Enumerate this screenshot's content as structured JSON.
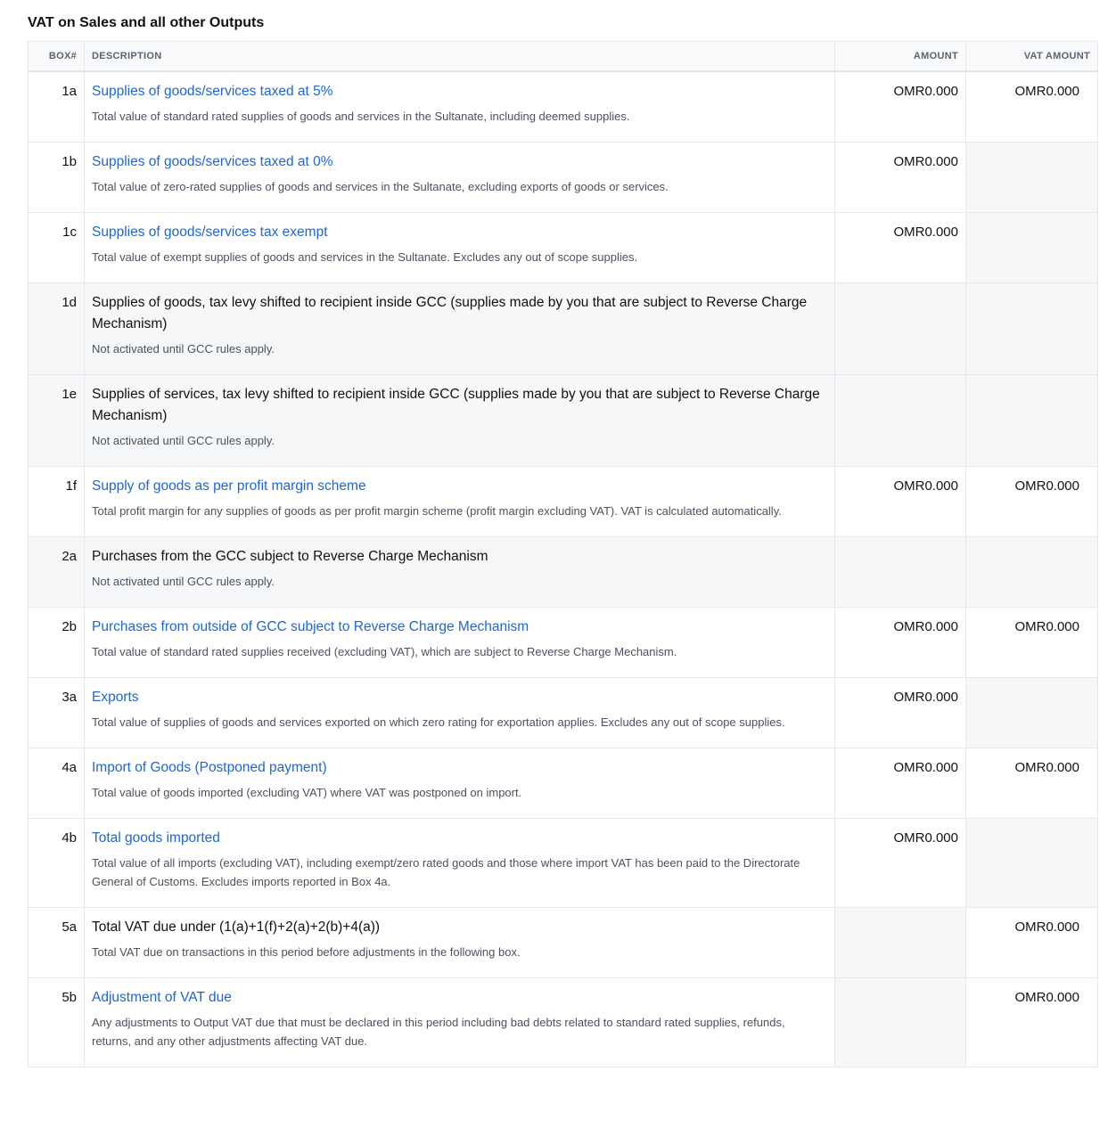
{
  "section_title": "VAT on Sales and all other Outputs",
  "headers": {
    "box": "BOX#",
    "description": "DESCRIPTION",
    "amount": "AMOUNT",
    "vat_amount": "VAT AMOUNT"
  },
  "rows": [
    {
      "box": "1a",
      "label": "Supplies of goods/services taxed at 5%",
      "help": "Total value of standard rated supplies of goods and services in the Sultanate, including deemed supplies.",
      "amount": "OMR0.000",
      "vat_amount": "OMR0.000",
      "linked": true
    },
    {
      "box": "1b",
      "label": "Supplies of goods/services taxed at 0%",
      "help": "Total value of zero-rated supplies of goods and services in the Sultanate, excluding exports of goods or services.",
      "amount": "OMR0.000",
      "vat_amount": "",
      "linked": true
    },
    {
      "box": "1c",
      "label": "Supplies of goods/services tax exempt",
      "help": "Total value of exempt supplies of goods and services in the Sultanate. Excludes any out of scope supplies.",
      "amount": "OMR0.000",
      "vat_amount": "",
      "linked": true
    },
    {
      "box": "1d",
      "label": "Supplies of goods, tax levy shifted to recipient inside GCC (supplies made by you that are subject to Reverse Charge Mechanism)",
      "help": "Not activated until GCC rules apply.",
      "amount": "",
      "vat_amount": "",
      "linked": false
    },
    {
      "box": "1e",
      "label": "Supplies of services, tax levy shifted to recipient inside GCC (supplies made by you that are subject to Reverse Charge Mechanism)",
      "help": "Not activated until GCC rules apply.",
      "amount": "",
      "vat_amount": "",
      "linked": false
    },
    {
      "box": "1f",
      "label": "Supply of goods as per profit margin scheme",
      "help": "Total profit margin for any supplies of goods as per profit margin scheme (profit margin excluding VAT). VAT is calculated automatically.",
      "amount": "OMR0.000",
      "vat_amount": "OMR0.000",
      "linked": true
    },
    {
      "box": "2a",
      "label": "Purchases from the GCC subject to Reverse Charge Mechanism",
      "help": "Not activated until GCC rules apply.",
      "amount": "",
      "vat_amount": "",
      "linked": false
    },
    {
      "box": "2b",
      "label": "Purchases from outside of GCC subject to Reverse Charge Mechanism",
      "help": "Total value of standard rated supplies received (excluding VAT), which are subject to Reverse Charge Mechanism.",
      "amount": "OMR0.000",
      "vat_amount": "OMR0.000",
      "linked": true
    },
    {
      "box": "3a",
      "label": "Exports",
      "help": "Total value of supplies of goods and services exported on which zero rating for exportation applies. Excludes any out of scope supplies.",
      "amount": "OMR0.000",
      "vat_amount": "",
      "linked": true
    },
    {
      "box": "4a",
      "label": "Import of Goods (Postponed payment)",
      "help": "Total value of goods imported (excluding VAT) where VAT was postponed on import.",
      "amount": "OMR0.000",
      "vat_amount": "OMR0.000",
      "linked": true
    },
    {
      "box": "4b",
      "label": "Total goods imported",
      "help": "Total value of all imports (excluding VAT), including exempt/zero rated goods and those where import VAT has been paid to the Directorate General of Customs. Excludes imports reported in Box 4a.",
      "amount": "OMR0.000",
      "vat_amount": "",
      "linked": true
    },
    {
      "box": "5a",
      "label": "Total VAT due under (1(a)+1(f)+2(a)+2(b)+4(a))",
      "help": "Total VAT due on transactions in this period before adjustments in the following box.",
      "amount": "",
      "vat_amount": "OMR0.000",
      "linked": false
    },
    {
      "box": "5b",
      "label": "Adjustment of VAT due",
      "help": "Any adjustments to Output VAT due that must be declared in this period including bad debts related to standard rated supplies, refunds, returns, and any other adjustments affecting VAT due.",
      "amount": "",
      "vat_amount": "OMR0.000",
      "linked": true
    }
  ]
}
